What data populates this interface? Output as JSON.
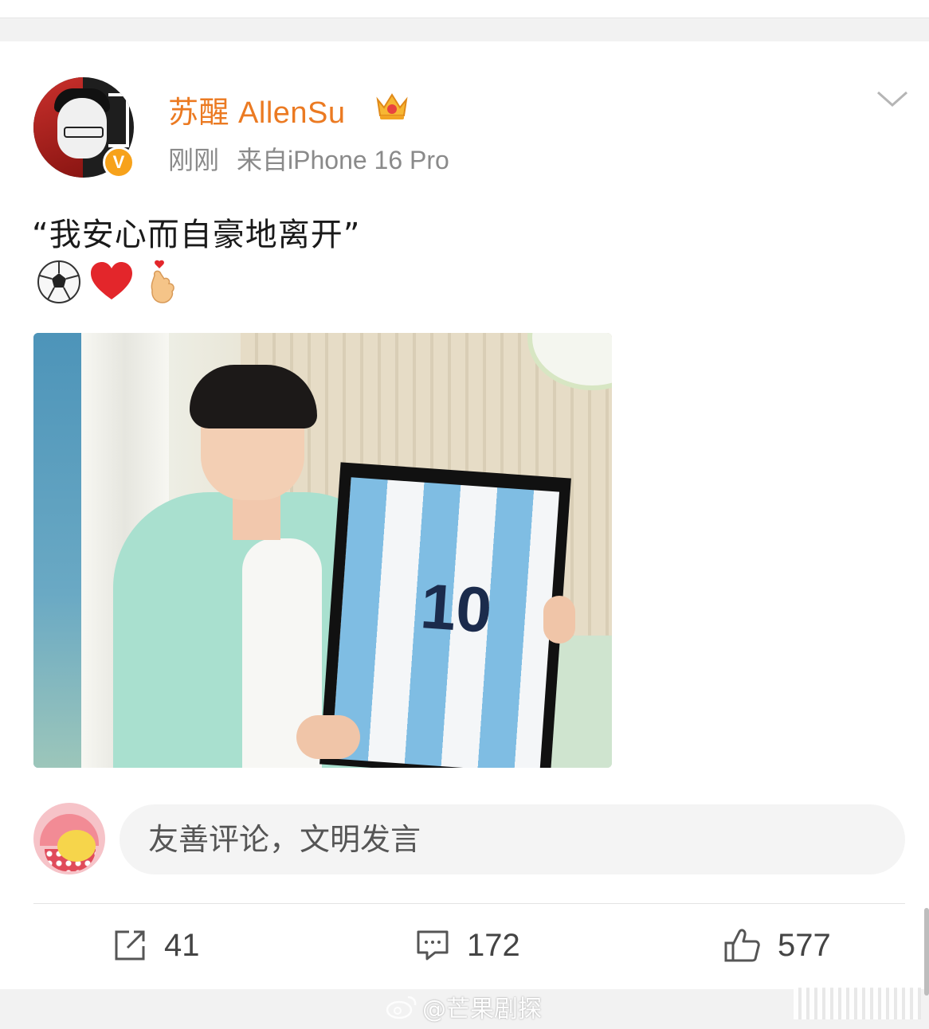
{
  "post": {
    "username": "苏醒 AllenSu",
    "time": "刚刚",
    "source": "来自iPhone 16 Pro",
    "text": "“我安心而自豪地离开”",
    "emojis": [
      "soccer-ball-icon",
      "red-heart-icon",
      "finger-heart-icon"
    ],
    "verified_badge": "V",
    "photo_number": "10"
  },
  "comment_box": {
    "placeholder": "友善评论，文明发言"
  },
  "actions": {
    "repost_count": "41",
    "comment_count": "172",
    "like_count": "577"
  },
  "watermark": {
    "text": "@芒果剧探"
  },
  "colors": {
    "username": "#eb7a22",
    "meta": "#8a8a8a",
    "verified": "#f7a21b",
    "background_gap": "#f2f2f2"
  }
}
